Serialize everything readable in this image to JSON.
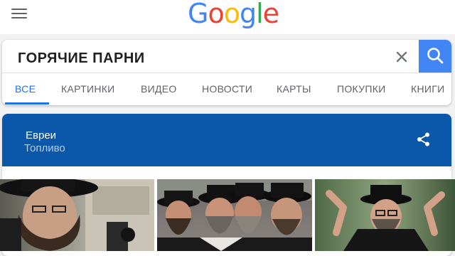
{
  "logo": {
    "letters": [
      "G",
      "o",
      "o",
      "g",
      "l",
      "e"
    ],
    "colors": [
      "#4285F4",
      "#EA4335",
      "#FBBC05",
      "#4285F4",
      "#34A853",
      "#EA4335"
    ]
  },
  "search": {
    "value": "ГОРЯЧИЕ ПАРНИ",
    "accent": "#4285F4"
  },
  "tabs": [
    "ВСЕ",
    "КАРТИНКИ",
    "ВИДЕО",
    "НОВОСТИ",
    "КАРТЫ",
    "ПОКУПКИ",
    "КНИГИ"
  ],
  "active_tab_color": "#1A73E8",
  "knowledge_panel": {
    "title": "Евреи",
    "subtitle": "Топливо",
    "header_color": "#0B57A9"
  },
  "icons": [
    "menu-icon",
    "close-icon",
    "search-icon",
    "share-icon"
  ]
}
